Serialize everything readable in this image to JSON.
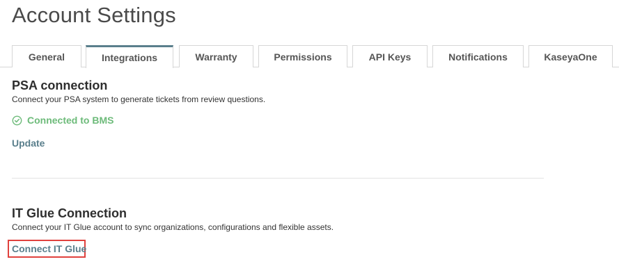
{
  "page": {
    "title": "Account Settings"
  },
  "tabs": [
    {
      "label": "General",
      "active": false
    },
    {
      "label": "Integrations",
      "active": true
    },
    {
      "label": "Warranty",
      "active": false
    },
    {
      "label": "Permissions",
      "active": false
    },
    {
      "label": "API Keys",
      "active": false
    },
    {
      "label": "Notifications",
      "active": false
    },
    {
      "label": "KaseyaOne",
      "active": false
    }
  ],
  "psa": {
    "title": "PSA connection",
    "description": "Connect your PSA system to generate tickets from review questions.",
    "status": "Connected to BMS",
    "status_icon": "check-circle-icon",
    "update_label": "Update"
  },
  "itglue": {
    "title": "IT Glue Connection",
    "description": "Connect your IT Glue account to sync organizations, configurations and flexible assets.",
    "connect_label": "Connect IT Glue"
  },
  "colors": {
    "accent": "#5a7f8c",
    "success": "#6dbb7a",
    "highlight": "#e0413d"
  }
}
